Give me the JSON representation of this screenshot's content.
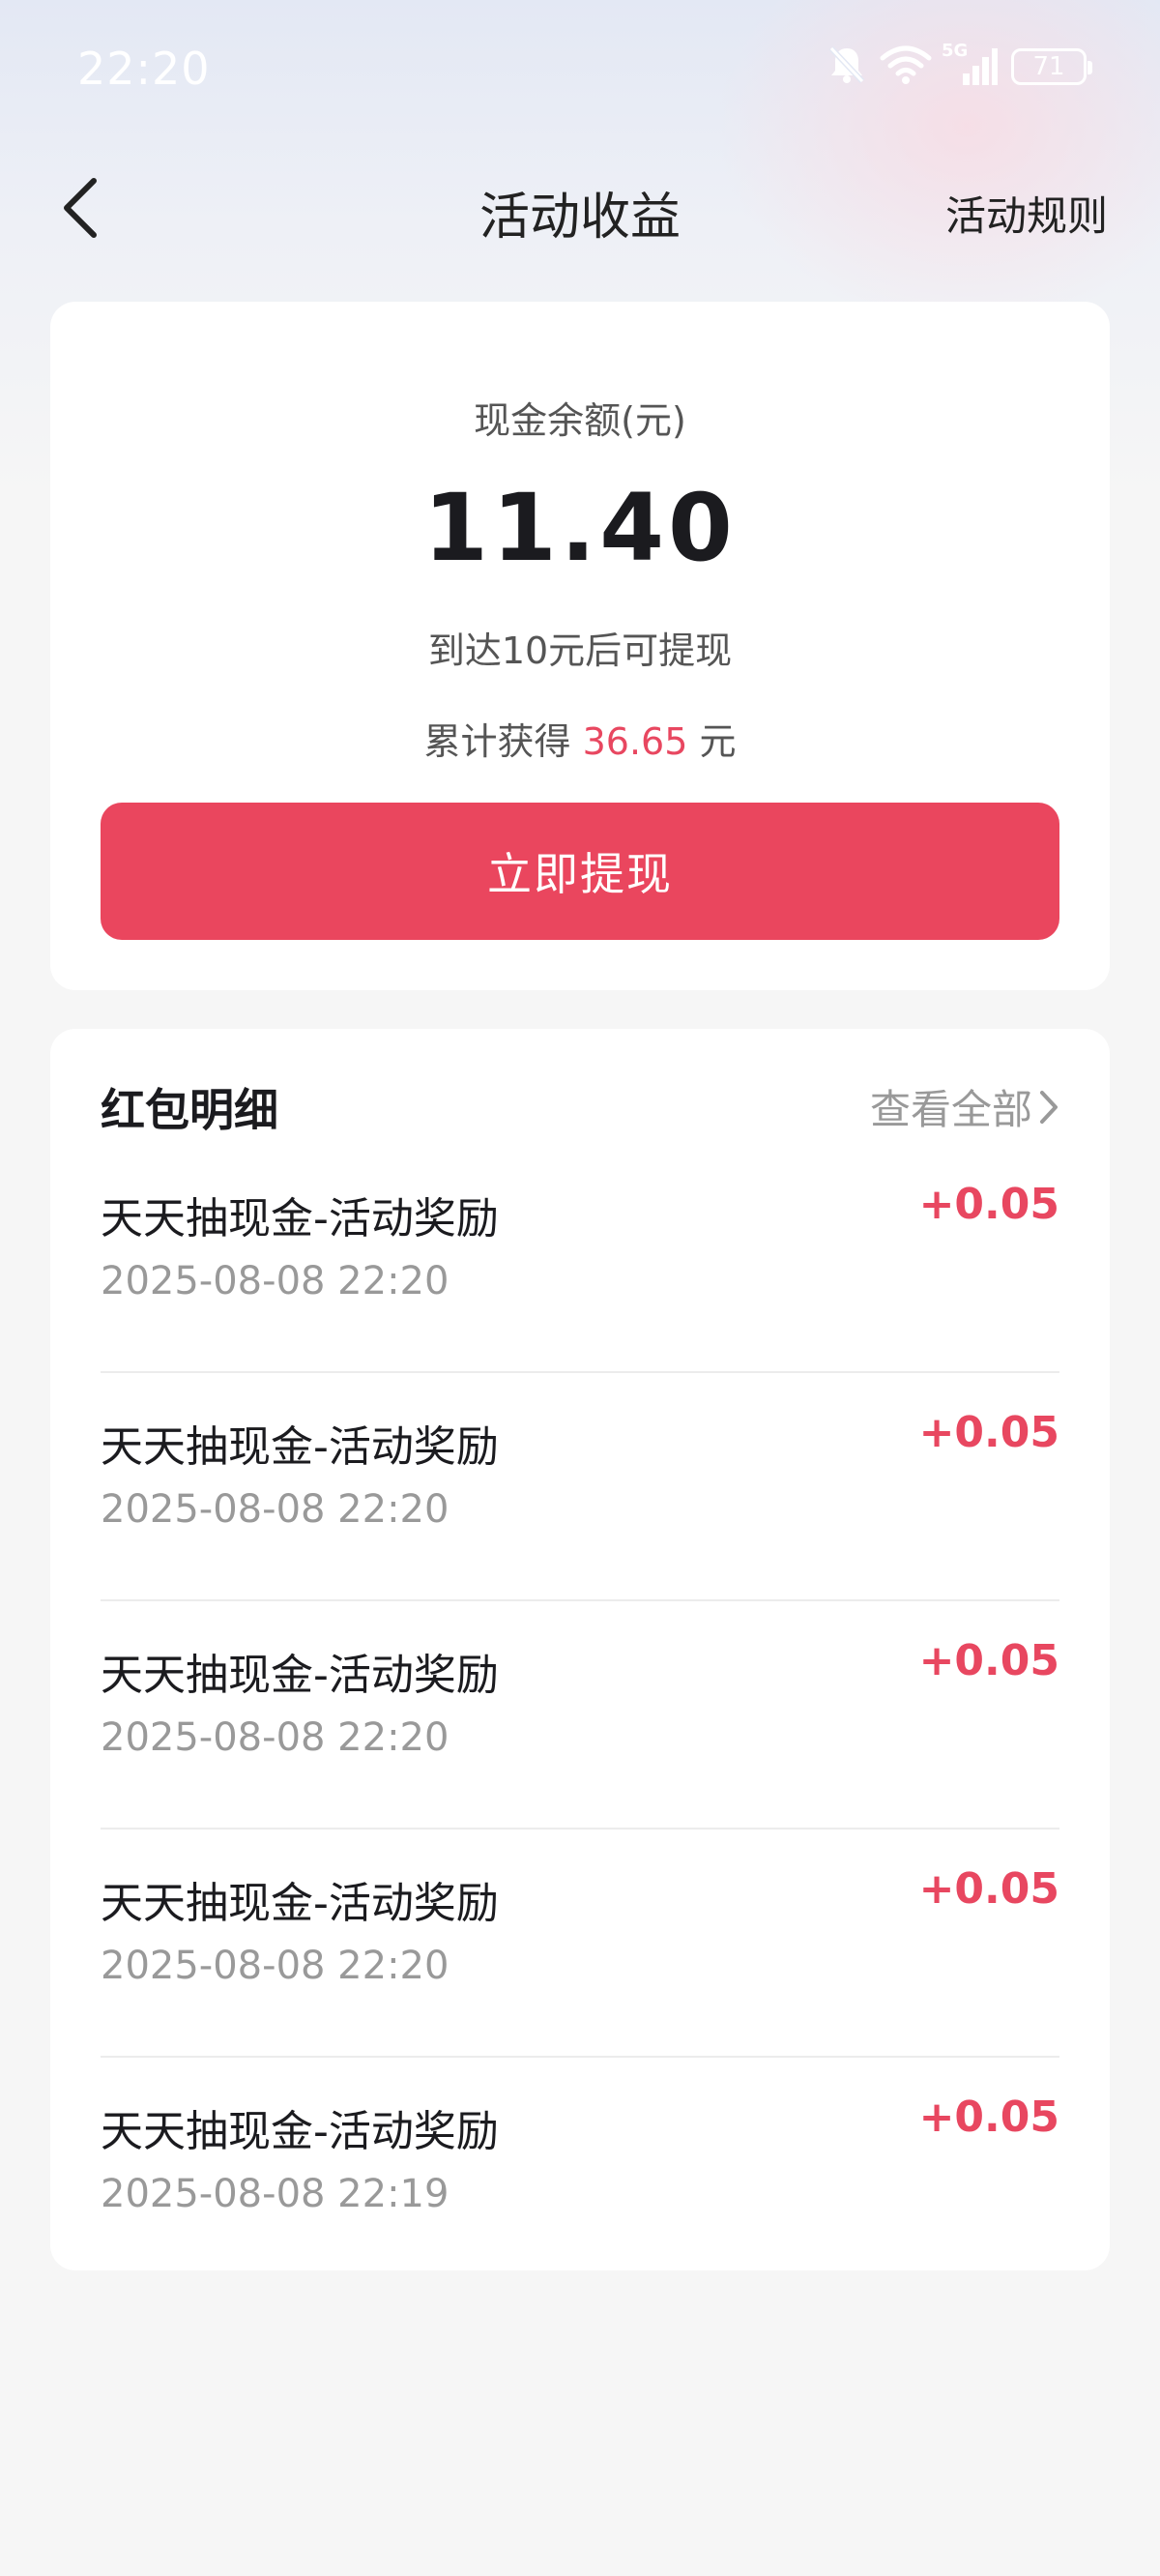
{
  "status_bar": {
    "time": "22:20",
    "battery": "71",
    "network": "5G",
    "icons": [
      "bell-muted-icon",
      "wifi-icon",
      "signal-icon",
      "battery-icon"
    ]
  },
  "nav": {
    "back_icon": "chevron-left-icon",
    "title": "活动收益",
    "rules_label": "活动规则"
  },
  "balance": {
    "label": "现金余额(元)",
    "amount": "11.40",
    "hint": "到达10元后可提现",
    "total_prefix": "累计获得",
    "total_value": "36.65",
    "total_suffix": "元",
    "withdraw_label": "立即提现"
  },
  "details": {
    "title": "红包明细",
    "view_all_label": "查看全部",
    "view_all_icon": "chevron-right-icon",
    "records": [
      {
        "title": "天天抽现金-活动奖励",
        "time": "2025-08-08 22:20",
        "amount": "+0.05"
      },
      {
        "title": "天天抽现金-活动奖励",
        "time": "2025-08-08 22:20",
        "amount": "+0.05"
      },
      {
        "title": "天天抽现金-活动奖励",
        "time": "2025-08-08 22:20",
        "amount": "+0.05"
      },
      {
        "title": "天天抽现金-活动奖励",
        "time": "2025-08-08 22:20",
        "amount": "+0.05"
      },
      {
        "title": "天天抽现金-活动奖励",
        "time": "2025-08-08 22:19",
        "amount": "+0.05"
      }
    ]
  },
  "colors": {
    "accent": "#ea465e",
    "accent_text": "#e84760",
    "muted_text": "#999999"
  }
}
